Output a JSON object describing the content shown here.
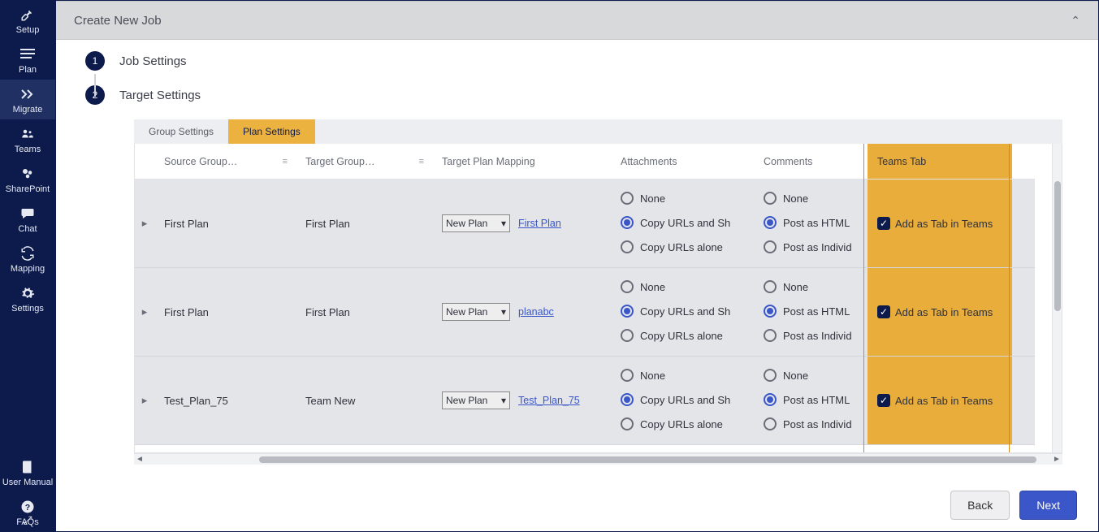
{
  "sidebar": {
    "items": [
      {
        "label": "Setup",
        "icon": "wrench"
      },
      {
        "label": "Plan",
        "icon": "list"
      },
      {
        "label": "Migrate",
        "icon": "chevrons"
      },
      {
        "label": "Teams",
        "icon": "teams"
      },
      {
        "label": "SharePoint",
        "icon": "sharepoint"
      },
      {
        "label": "Chat",
        "icon": "chat"
      },
      {
        "label": "Mapping",
        "icon": "sync"
      },
      {
        "label": "Settings",
        "icon": "gear"
      }
    ],
    "bottom": [
      {
        "label": "User Manual",
        "icon": "book"
      },
      {
        "label": "FAQs",
        "icon": "help"
      }
    ]
  },
  "panel": {
    "title": "Create New Job"
  },
  "steps": {
    "s1": "Job Settings",
    "s2": "Target Settings"
  },
  "tabs": {
    "group": "Group Settings",
    "plan": "Plan Settings"
  },
  "columns": {
    "src": "Source Group…",
    "tgt": "Target Group…",
    "map": "Target Plan Mapping",
    "att": "Attachments",
    "com": "Comments",
    "tt": "Teams Tab"
  },
  "radios": {
    "att": [
      "None",
      "Copy URLs and Sh",
      "Copy URLs alone"
    ],
    "com": [
      "None",
      "Post as HTML",
      "Post as Individ"
    ]
  },
  "check_label": "Add as Tab in Teams",
  "map_select": "New Plan",
  "rows": [
    {
      "src": "First Plan",
      "tgt": "First Plan",
      "link": "First Plan",
      "att_sel": 1,
      "com_sel": 1,
      "tab": true
    },
    {
      "src": "First Plan",
      "tgt": "First Plan",
      "link": "planabc",
      "att_sel": 1,
      "com_sel": 1,
      "tab": true
    },
    {
      "src": "Test_Plan_75",
      "tgt": "Team New",
      "link": "Test_Plan_75",
      "att_sel": 1,
      "com_sel": 1,
      "tab": true
    }
  ],
  "buttons": {
    "back": "Back",
    "next": "Next"
  }
}
